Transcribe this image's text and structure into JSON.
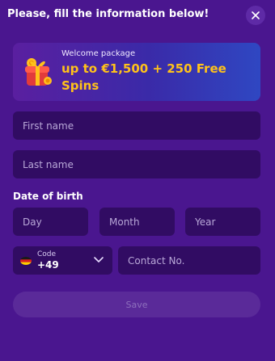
{
  "header": {
    "title": "Please, fill the information below!",
    "close_icon": "close-icon"
  },
  "banner": {
    "small": "Welcome package",
    "big": "up to €1,500 + 250 Free Spins",
    "icon": "gift-icon"
  },
  "form": {
    "first_name_placeholder": "First name",
    "last_name_placeholder": "Last name",
    "dob_label": "Date of birth",
    "day_placeholder": "Day",
    "month_placeholder": "Month",
    "year_placeholder": "Year",
    "code_label": "Code",
    "code_value": "+49",
    "flag_icon": "germany-flag-icon",
    "contact_placeholder": "Contact No.",
    "save_label": "Save"
  },
  "colors": {
    "background": "#4a168f",
    "field": "#310c63",
    "accent_yellow": "#ffc21a",
    "button_disabled": "#5a2a99"
  }
}
